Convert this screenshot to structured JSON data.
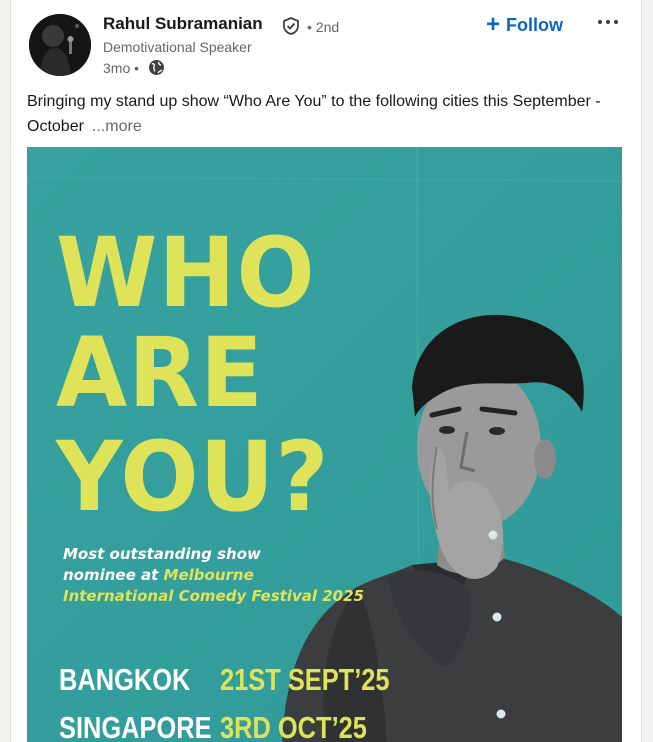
{
  "post": {
    "author": {
      "name": "Rahul Subramanian",
      "degree": "• 2nd",
      "headline": "Demotivational Speaker",
      "time": "3mo •"
    },
    "follow_label": "Follow",
    "text": "Bringing my stand up show “Who Are You” to the following cities this September - October",
    "see_more": "...more"
  },
  "poster": {
    "title": [
      "WHO",
      "ARE",
      "YOU?"
    ],
    "tagline": {
      "line1": "Most outstanding show",
      "line2_prefix": "nominee at ",
      "line2_highlight": "Melbourne",
      "line3_highlight": "International Comedy Fe",
      "line3_rest": "stival 2025"
    },
    "schedule": [
      {
        "city": "BANGKOK",
        "date": "21ST SEPT’25"
      },
      {
        "city": "SINGAPORE",
        "date": "3RD OCT’25"
      }
    ]
  },
  "icons": {
    "verified": "verified-shield-icon",
    "visibility": "globe-icon",
    "more": "more-horizontal-icon",
    "follow": "plus-icon"
  },
  "colors": {
    "link_blue": "#0a66c2",
    "poster_teal": "#3aa4a0",
    "poster_yellow": "#dfe35a"
  }
}
